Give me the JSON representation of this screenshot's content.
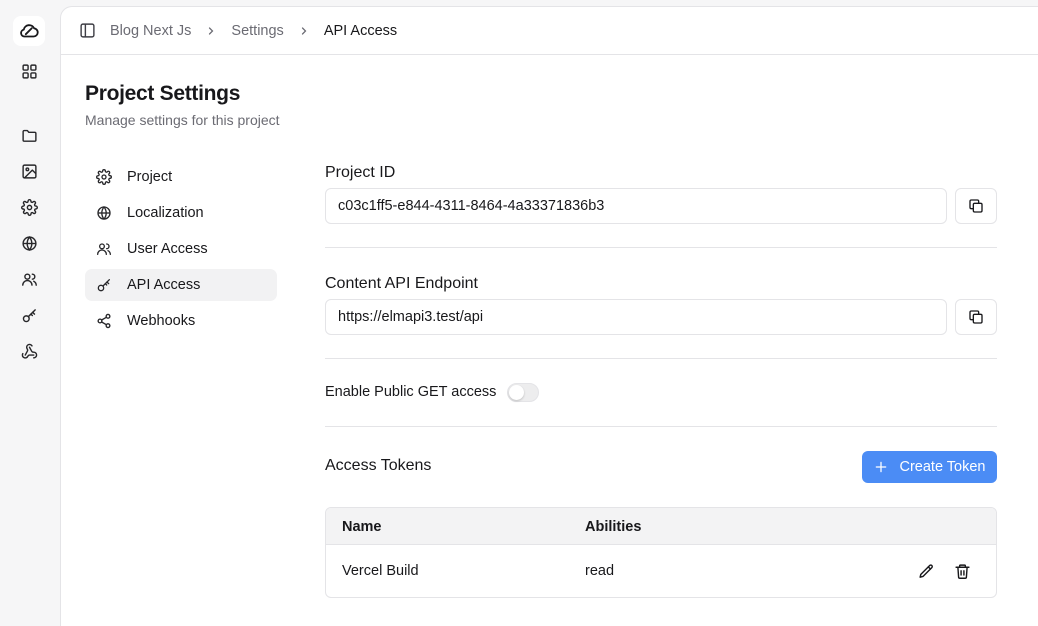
{
  "breadcrumb": [
    "Blog Next Js",
    "Settings",
    "API Access"
  ],
  "page": {
    "title": "Project Settings",
    "subtitle": "Manage settings for this project"
  },
  "rail_icons": [
    "cloud-logo-icon",
    "grid-icon",
    "folder-icon",
    "image-icon",
    "gear-icon",
    "globe-icon",
    "users-icon",
    "key-icon",
    "webhook-icon"
  ],
  "nav": {
    "items": [
      {
        "label": "Project",
        "icon": "gear-icon"
      },
      {
        "label": "Localization",
        "icon": "globe-icon"
      },
      {
        "label": "User Access",
        "icon": "users-icon"
      },
      {
        "label": "API Access",
        "icon": "key-icon",
        "active": true
      },
      {
        "label": "Webhooks",
        "icon": "webhook-icon"
      }
    ]
  },
  "project_id": {
    "label": "Project ID",
    "value": "c03c1ff5-e844-4311-8464-4a33371836b3"
  },
  "endpoint": {
    "label": "Content API Endpoint",
    "value": "https://elmapi3.test/api"
  },
  "public_get": {
    "label": "Enable Public GET access",
    "enabled": false
  },
  "tokens": {
    "title": "Access Tokens",
    "create_label": "Create Token",
    "columns": [
      "Name",
      "Abilities"
    ],
    "rows": [
      {
        "name": "Vercel Build",
        "abilities": "read"
      }
    ]
  },
  "colors": {
    "accent": "#4b8cf5",
    "border": "#e4e4e7",
    "muted_text": "#6b6b73"
  }
}
